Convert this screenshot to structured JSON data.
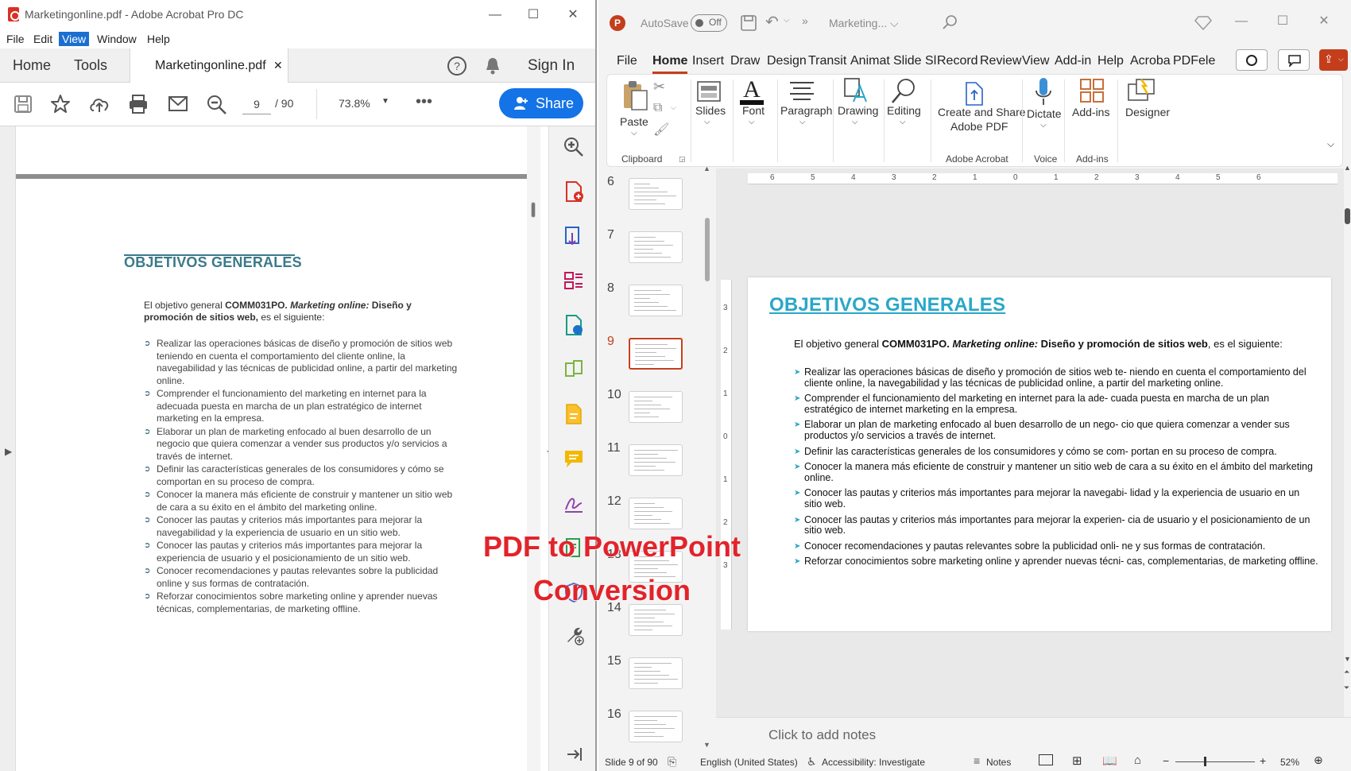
{
  "acrobat": {
    "title": "Marketingonline.pdf - Adobe Acrobat Pro DC",
    "menu": [
      "File",
      "Edit",
      "View",
      "Window",
      "Help"
    ],
    "tabs": {
      "home": "Home",
      "tools": "Tools",
      "doc": "Marketingonline.pdf",
      "sign_in": "Sign In"
    },
    "toolbar": {
      "page_current": "9",
      "page_total": "/ 90",
      "zoom": "73.8%",
      "more": "•••",
      "share": "Share"
    },
    "page": {
      "heading": "OBJETIVOS GENERALES",
      "intro_pre": "El objetivo general ",
      "intro_code": "COMM031PO.",
      "intro_title": " Marketing online:",
      "intro_bold": " Diseño y promoción de sitios web,",
      "intro_post": " es el siguiente:",
      "items": [
        "Realizar las operaciones básicas de diseño y promoción de sitios web teniendo en cuenta el comportamiento del cliente online, la navegabilidad y las técnicas de publicidad online, a partir del marketing online.",
        "Comprender el funcionamiento del marketing en internet para la adecuada puesta en marcha de un plan estratégico de internet marketing en la empresa.",
        "Elaborar un plan de marketing enfocado al buen desarrollo de un negocio que quiera comenzar a vender sus productos y/o servicios a través de internet.",
        "Definir las características generales de los consumidores y cómo se comportan en su proceso de compra.",
        "Conocer la manera más eficiente de construir y mantener un sitio web de cara a su éxito en el ámbito del marketing online.",
        "Conocer las pautas y criterios más importantes para mejorar la navegabilidad y la experiencia de usuario en un sitio web.",
        "Conocer las pautas y criterios más importantes para mejorar la experiencia de usuario y el posicionamiento de un sitio web.",
        "Conocer recomendaciones y pautas relevantes sobre la publicidad online y sus formas de contratación.",
        "Reforzar conocimientos sobre marketing online y aprender nuevas técnicas, complementarias, de marketing offline."
      ]
    }
  },
  "ppt": {
    "autosave": "AutoSave",
    "autosave_state": "Off",
    "doc_title": "Marketing... ⌵",
    "tabs": [
      "File",
      "Home",
      "Insert",
      "Draw",
      "Design",
      "Transit",
      "Animat",
      "Slide Sl",
      "Record",
      "Review",
      "View",
      "Add-in",
      "Help",
      "Acroba",
      "PDFele"
    ],
    "ribbon": {
      "paste": "Paste",
      "clipboard": "Clipboard",
      "slides": "Slides",
      "font": "Font",
      "paragraph": "Paragraph",
      "drawing": "Drawing",
      "editing": "Editing",
      "create_share_1": "Create and Share",
      "create_share_2": "Adobe PDF",
      "adobe_acrobat": "Adobe Acrobat",
      "dictate": "Dictate",
      "voice": "Voice",
      "addins": "Add-ins",
      "addins_group": "Add-ins",
      "designer": "Designer"
    },
    "thumbs": [
      "6",
      "7",
      "8",
      "9",
      "10",
      "11",
      "12",
      "13",
      "14",
      "15",
      "16"
    ],
    "ruler_h": [
      "6",
      "5",
      "4",
      "3",
      "2",
      "1",
      "0",
      "1",
      "2",
      "3",
      "4",
      "5",
      "6"
    ],
    "ruler_v": [
      "3",
      "2",
      "1",
      "0",
      "1",
      "2",
      "3"
    ],
    "slide": {
      "heading": "OBJETIVOS GENERALES",
      "intro_pre": "El objetivo general ",
      "intro_code": "COMM031PO.",
      "intro_title": " Marketing online:",
      "intro_bold": " Diseño y promoción de sitios web",
      "intro_post": ", es el siguiente:",
      "items": [
        "Realizar las operaciones básicas de diseño y promoción de sitios web te- niendo en cuenta el comportamiento del cliente online, la navegabilidad y las técnicas de publicidad online, a partir del marketing online.",
        "Comprender el funcionamiento del marketing en internet para la ade- cuada puesta en marcha de un plan estratégico de internet marketing en la empresa.",
        "Elaborar un plan de marketing enfocado al buen desarrollo de un nego- cio que quiera comenzar a vender sus productos y/o servicios a través de internet.",
        "Definir las características generales de los consumidores y cómo se com- portan en su proceso de compra.",
        "Conocer la manera más eficiente de construir y mantener un sitio web de cara a su éxito en el ámbito del marketing online.",
        "Conocer las pautas y criterios más importantes para mejorar la navegabi- lidad y la experiencia de usuario en un sitio web.",
        "Conocer las pautas y criterios más importantes para mejorar la experien- cia de usuario y el posicionamiento de un sitio web.",
        "Conocer recomendaciones y pautas relevantes sobre la publicidad onli- ne y sus formas de contratación.",
        "Reforzar conocimientos sobre marketing online y aprender nuevas técni- cas, complementarias, de marketing offline."
      ]
    },
    "notes_placeholder": "Click to add notes",
    "status": {
      "slide": "Slide 9 of 90",
      "language": "English (United States)",
      "accessibility": "Accessibility: Investigate",
      "notes": "Notes",
      "zoom": "52%"
    }
  },
  "overlay": {
    "line1": "PDF to PowerPoint",
    "line2": "Conversion"
  }
}
